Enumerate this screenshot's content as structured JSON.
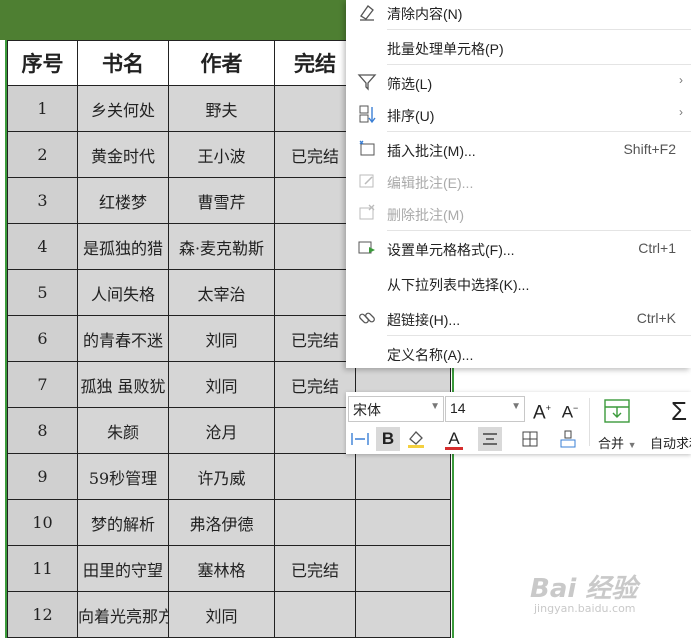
{
  "sheet": {
    "headers": [
      "序号",
      "书名",
      "作者",
      "完结"
    ],
    "rows": [
      {
        "no": "1",
        "book": "乡关何处",
        "author": "野夫",
        "done": ""
      },
      {
        "no": "2",
        "book": "黄金时代",
        "author": "王小波",
        "done": "已完结"
      },
      {
        "no": "3",
        "book": "红楼梦",
        "author": "曹雪芹",
        "done": ""
      },
      {
        "no": "4",
        "book": "是孤独的猎",
        "author": "森·麦克勒斯",
        "done": ""
      },
      {
        "no": "5",
        "book": "人间失格",
        "author": "太宰治",
        "done": ""
      },
      {
        "no": "6",
        "book": "的青春不迷",
        "author": "刘同",
        "done": "已完结"
      },
      {
        "no": "7",
        "book": "孤独 虽败犹",
        "author": "刘同",
        "done": "已完结"
      },
      {
        "no": "8",
        "book": "朱颜",
        "author": "沧月",
        "done": ""
      },
      {
        "no": "9",
        "book": "59秒管理",
        "author": "许乃威",
        "done": ""
      },
      {
        "no": "10",
        "book": "梦的解析",
        "author": "弗洛伊德",
        "done": ""
      },
      {
        "no": "11",
        "book": "田里的守望",
        "author": "塞林格",
        "done": "已完结"
      },
      {
        "no": "12",
        "book": "向着光亮那方",
        "author": "刘同",
        "done": ""
      }
    ]
  },
  "menu": {
    "clear": "清除内容(N)",
    "batch": "批量处理单元格(P)",
    "filter": "筛选(L)",
    "sort": "排序(U)",
    "insert_comment": "插入批注(M)...",
    "insert_comment_sc": "Shift+F2",
    "edit_comment": "编辑批注(E)...",
    "delete_comment": "删除批注(M)",
    "format_cells": "设置单元格格式(F)...",
    "format_cells_sc": "Ctrl+1",
    "pick_list": "从下拉列表中选择(K)...",
    "hyperlink": "超链接(H)...",
    "hyperlink_sc": "Ctrl+K",
    "define_name": "定义名称(A)..."
  },
  "toolbar": {
    "font": "宋体",
    "size": "14",
    "bold": "B",
    "merge": "合并",
    "autosum": "自动求和"
  },
  "watermark": {
    "main": "Bai 经验",
    "url": "jingyan.baidu.com"
  },
  "colors": {
    "accent_green": "#3b9a3b",
    "header_green": "#4e7f32",
    "cell_gray": "#d6d6d6"
  }
}
